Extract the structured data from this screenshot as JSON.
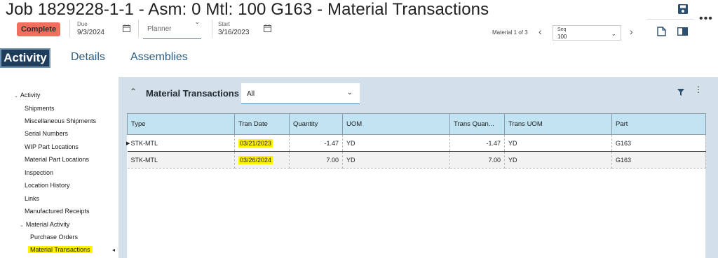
{
  "header": {
    "title": "Job 1829228-1-1 - Asm: 0 Mtl: 100 G163 - Material Transactions",
    "status_button": "Complete",
    "due_label": "Due",
    "due_value": "9/3/2024",
    "planner_placeholder": "Planner",
    "start_label": "Start",
    "start_value": "3/16/2023",
    "material_counter": "Material 1 of 3",
    "seq_label": "Seq",
    "seq_value": "100",
    "icons": [
      "save-icon",
      "more-icon",
      "calendar-icon",
      "chevron-left-icon",
      "chevron-right-icon",
      "document-icon",
      "panel-icon"
    ]
  },
  "tabs": [
    {
      "label": "Activity",
      "active": true
    },
    {
      "label": "Details",
      "active": false
    },
    {
      "label": "Assemblies",
      "active": false
    }
  ],
  "tree": {
    "root": "Activity",
    "items": [
      "Shipments",
      "Miscellaneous Shipments",
      "Serial Numbers",
      "WIP Part Locations",
      "Material Part Locations",
      "Inspection",
      "Location History",
      "Links",
      "Manufactured Receipts"
    ],
    "material_activity": "Material Activity",
    "sub_items": [
      "Purchase Orders",
      "Material Transactions"
    ],
    "selected": "Material Transactions"
  },
  "panel": {
    "title": "Material Transactions",
    "filter_value": "All"
  },
  "grid": {
    "columns": [
      "Type",
      "Tran Date",
      "Quantity",
      "UOM",
      "Trans Quan...",
      "Trans UOM",
      "Part"
    ],
    "rows": [
      {
        "type": "STK-MTL",
        "tran_date": "03/21/2023",
        "quantity": "-1.47",
        "uom": "YD",
        "trans_qty": "-1.47",
        "trans_uom": "YD",
        "part": "G163"
      },
      {
        "type": "STK-MTL",
        "tran_date": "03/26/2024",
        "quantity": "7.00",
        "uom": "YD",
        "trans_qty": "7.00",
        "trans_uom": "YD",
        "part": "G163"
      }
    ]
  },
  "colors": {
    "status_button": "#f26f5f",
    "active_tab": "#1f3d5a",
    "grid_header": "#c2e3f2",
    "panel_bg": "#d3dfe9",
    "highlight": "#fff200",
    "link": "#2a5d85"
  }
}
